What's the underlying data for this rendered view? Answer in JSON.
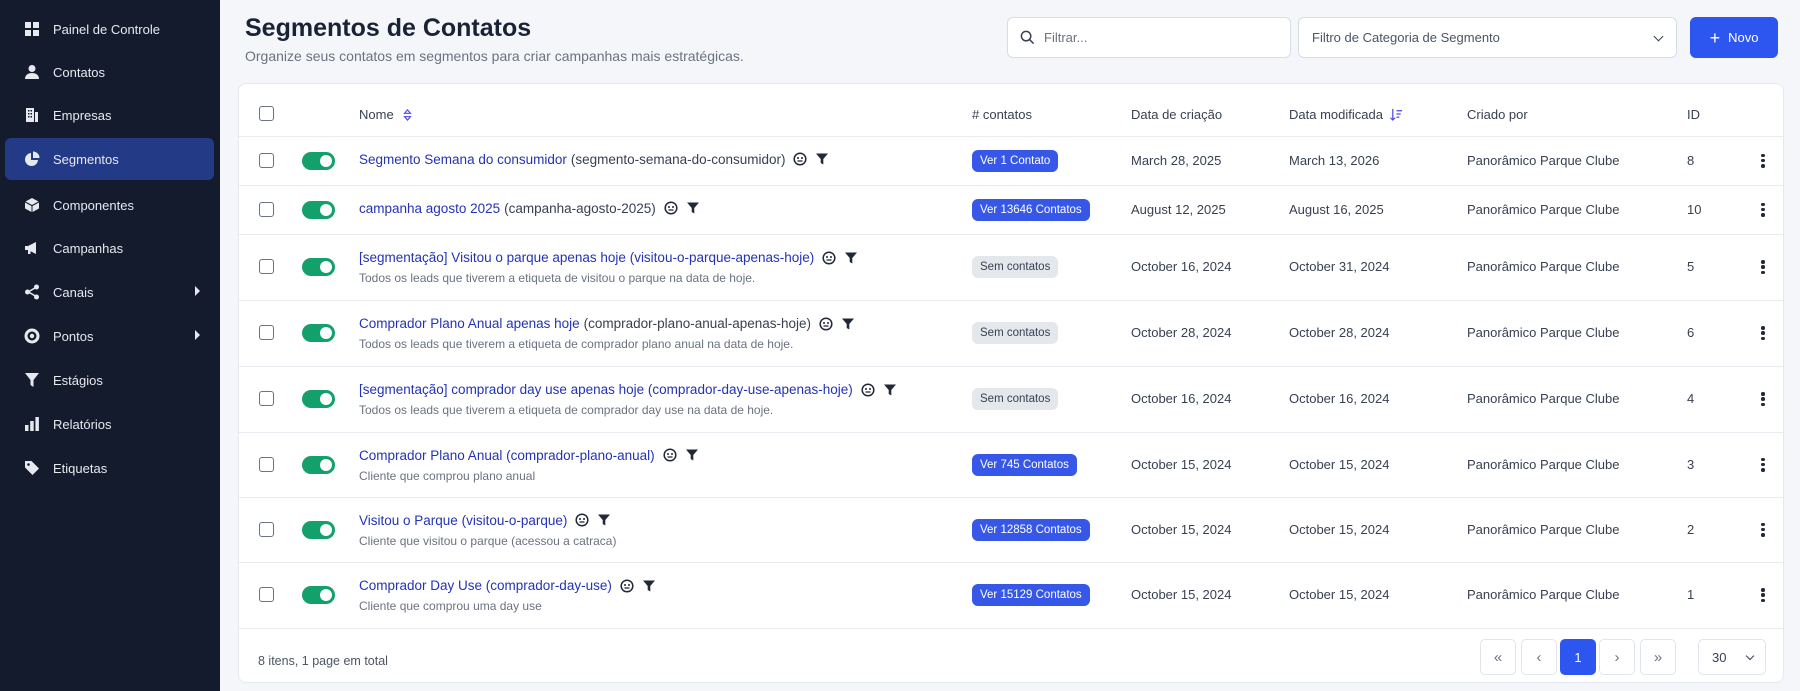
{
  "sidebar": {
    "items": [
      {
        "label": "Painel de Controle",
        "icon": "grid-icon"
      },
      {
        "label": "Contatos",
        "icon": "user-icon"
      },
      {
        "label": "Empresas",
        "icon": "building-icon"
      },
      {
        "label": "Segmentos",
        "icon": "pie-chart-icon",
        "active": true
      },
      {
        "label": "Componentes",
        "icon": "cube-icon"
      },
      {
        "label": "Campanhas",
        "icon": "megaphone-icon"
      },
      {
        "label": "Canais",
        "icon": "share-icon",
        "submenu": true
      },
      {
        "label": "Pontos",
        "icon": "target-icon",
        "submenu": true
      },
      {
        "label": "Estágios",
        "icon": "filter-icon"
      },
      {
        "label": "Relatórios",
        "icon": "bar-chart-icon"
      },
      {
        "label": "Etiquetas",
        "icon": "tag-icon"
      }
    ]
  },
  "header": {
    "title": "Segmentos de Contatos",
    "subtitle": "Organize seus contatos em segmentos para criar campanhas mais estratégicas.",
    "search_placeholder": "Filtrar...",
    "category_filter": "Filtro de Categoria de Segmento",
    "new_button": "Novo"
  },
  "table": {
    "columns": {
      "name": "Nome",
      "contacts": "# contatos",
      "created": "Data de criação",
      "modified": "Data modificada",
      "created_by": "Criado por",
      "id": "ID"
    },
    "rows": [
      {
        "name": "Segmento Semana do consumidor",
        "alias": "(segmento-semana-do-consumidor)",
        "description": "",
        "contacts": "Ver 1 Contato",
        "contacts_style": "blue",
        "created": "March 28, 2025",
        "modified": "March 13, 2026",
        "created_by": "Panorâmico Parque Clube",
        "id": "8",
        "enabled": true
      },
      {
        "name": "campanha agosto 2025",
        "alias": "(campanha-agosto-2025)",
        "description": "",
        "contacts": "Ver 13646 Contatos",
        "contacts_style": "blue",
        "created": "August 12, 2025",
        "modified": "August 16, 2025",
        "created_by": "Panorâmico Parque Clube",
        "id": "10",
        "enabled": true
      },
      {
        "name": "[segmentação] Visitou o parque apenas hoje (visitou-o-parque-apenas-hoje)",
        "alias": "",
        "description": "Todos os leads que tiverem a etiqueta de visitou o parque na data de hoje.",
        "contacts": "Sem contatos",
        "contacts_style": "gray",
        "created": "October 16, 2024",
        "modified": "October 31, 2024",
        "created_by": "Panorâmico Parque Clube",
        "id": "5",
        "enabled": true
      },
      {
        "name": "Comprador Plano Anual apenas hoje",
        "alias": "(comprador-plano-anual-apenas-hoje)",
        "description": "Todos os leads que tiverem a etiqueta de comprador plano anual  na data de hoje.",
        "contacts": "Sem contatos",
        "contacts_style": "gray",
        "created": "October 28, 2024",
        "modified": "October 28, 2024",
        "created_by": "Panorâmico Parque Clube",
        "id": "6",
        "enabled": true
      },
      {
        "name": "[segmentação] comprador day use apenas hoje (comprador-day-use-apenas-hoje)",
        "alias": "",
        "description": "Todos os leads que tiverem a etiqueta de comprador day use na data de hoje.",
        "contacts": "Sem contatos",
        "contacts_style": "gray",
        "created": "October 16, 2024",
        "modified": "October 16, 2024",
        "created_by": "Panorâmico Parque Clube",
        "id": "4",
        "enabled": true
      },
      {
        "name": "Comprador Plano Anual (comprador-plano-anual)",
        "alias": "",
        "description": "Cliente que comprou plano anual",
        "contacts": "Ver 745 Contatos",
        "contacts_style": "blue",
        "created": "October 15, 2024",
        "modified": "October 15, 2024",
        "created_by": "Panorâmico Parque Clube",
        "id": "3",
        "enabled": true
      },
      {
        "name": "Visitou o Parque (visitou-o-parque)",
        "alias": "",
        "description": "Cliente que visitou o parque (acessou a catraca)",
        "contacts": "Ver 12858 Contatos",
        "contacts_style": "blue",
        "created": "October 15, 2024",
        "modified": "October 15, 2024",
        "created_by": "Panorâmico Parque Clube",
        "id": "2",
        "enabled": true
      },
      {
        "name": "Comprador Day Use (comprador-day-use)",
        "alias": "",
        "description": "Cliente que comprou uma day use",
        "contacts": "Ver 15129 Contatos",
        "contacts_style": "blue",
        "created": "October 15, 2024",
        "modified": "October 15, 2024",
        "created_by": "Panorâmico Parque Clube",
        "id": "1",
        "enabled": true
      }
    ]
  },
  "footer": {
    "summary": "8 itens, 1 page em total",
    "current_page": "1",
    "per_page": "30"
  },
  "colors": {
    "accent": "#2d55f0",
    "sidebar_bg": "#141b2d",
    "sidebar_active": "#233a86",
    "toggle_on": "#14a06a",
    "link": "#2333b5"
  }
}
